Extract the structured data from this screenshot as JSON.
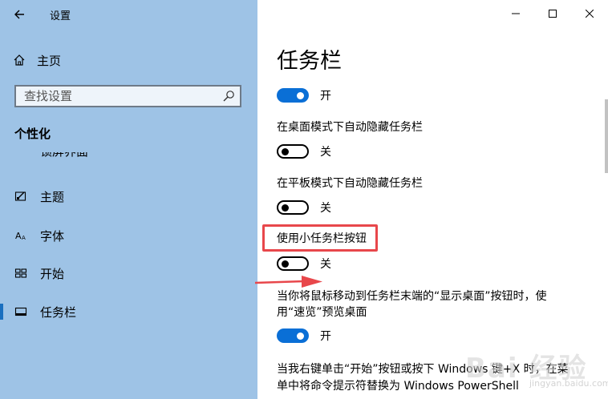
{
  "window": {
    "app_title": "设置"
  },
  "sidebar": {
    "home_label": "主页",
    "search_placeholder": "查找设置",
    "section_title": "个性化",
    "partial_item": "锁屏界面",
    "items": [
      {
        "label": "主题",
        "icon": "theme-icon"
      },
      {
        "label": "字体",
        "icon": "font-icon"
      },
      {
        "label": "开始",
        "icon": "start-icon"
      },
      {
        "label": "任务栏",
        "icon": "taskbar-icon",
        "active": true
      }
    ]
  },
  "main": {
    "page_title": "任务栏",
    "settings": [
      {
        "label": "",
        "state": "开",
        "on": true
      },
      {
        "label": "在桌面模式下自动隐藏任务栏",
        "state": "关",
        "on": false
      },
      {
        "label": "在平板模式下自动隐藏任务栏",
        "state": "关",
        "on": false
      },
      {
        "label": "使用小任务栏按钮",
        "state": "关",
        "on": false
      },
      {
        "label_line1": "当你将鼠标移动到任务栏末端的“显示桌面”按钮时，使",
        "label_line2": "用“速览”预览桌面",
        "state": "开",
        "on": true
      },
      {
        "label_line1": "当我右键单击“开始”按钮或按下 Windows 键+X 时，在菜",
        "label_line2": "单中将命令提示符替换为 Windows PowerShell"
      }
    ]
  },
  "watermark": {
    "text": "Bai 经验",
    "sub": "jingyan.baidu.com"
  },
  "colors": {
    "sidebar_bg": "#9ec3e6",
    "accent": "#0a6fd6",
    "highlight": "#e8474b"
  }
}
